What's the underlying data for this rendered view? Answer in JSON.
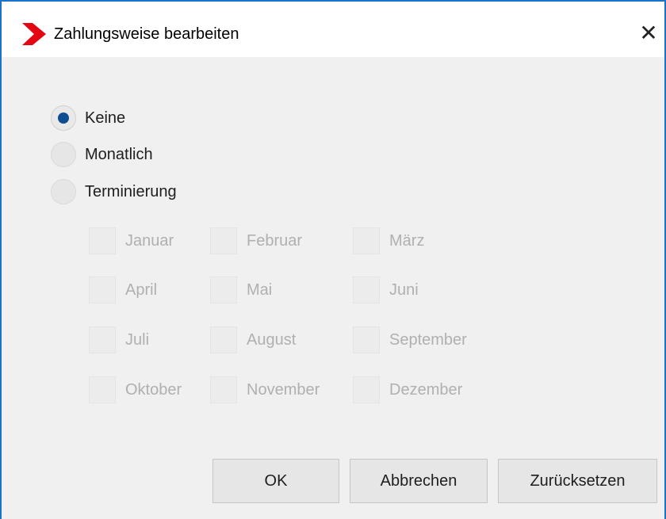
{
  "dialog": {
    "title": "Zahlungsweise bearbeiten",
    "close_glyph": "✕",
    "brand_color": "#e30613",
    "accent_color": "#1a73c9"
  },
  "payment_mode": {
    "options": [
      {
        "label": "Keine",
        "checked": true
      },
      {
        "label": "Monatlich",
        "checked": false
      },
      {
        "label": "Terminierung",
        "checked": false
      }
    ]
  },
  "months": {
    "enabled": false,
    "items": [
      {
        "label": "Januar",
        "checked": false
      },
      {
        "label": "Februar",
        "checked": false
      },
      {
        "label": "März",
        "checked": false
      },
      {
        "label": "April",
        "checked": false
      },
      {
        "label": "Mai",
        "checked": false
      },
      {
        "label": "Juni",
        "checked": false
      },
      {
        "label": "Juli",
        "checked": false
      },
      {
        "label": "August",
        "checked": false
      },
      {
        "label": "September",
        "checked": false
      },
      {
        "label": "Oktober",
        "checked": false
      },
      {
        "label": "November",
        "checked": false
      },
      {
        "label": "Dezember",
        "checked": false
      }
    ]
  },
  "buttons": {
    "ok": "OK",
    "cancel": "Abbrechen",
    "reset": "Zurücksetzen"
  }
}
